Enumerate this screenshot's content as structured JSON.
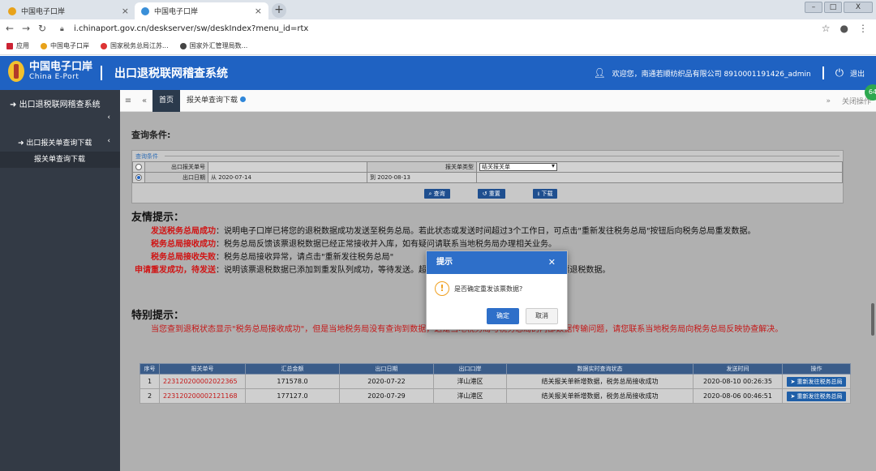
{
  "browser": {
    "tabs": [
      {
        "label": "中国电子口岸"
      },
      {
        "label": "中国电子口岸"
      }
    ],
    "url": "i.chinaport.gov.cn/deskserver/sw/deskIndex?menu_id=rtx",
    "bookmarks": [
      "应用",
      "中国电子口岸",
      "国家税务总局江苏...",
      "国家外汇管理局数..."
    ]
  },
  "header": {
    "logo_cn": "中国电子口岸",
    "logo_en": "China E-Port",
    "system_title": "出口退税联网稽查系统",
    "welcome": "欢迎您，南通若顺纺织品有限公司 8910001191426_admin",
    "logout": "退出"
  },
  "sidebar": {
    "main": "出口退税联网稽查系统",
    "sub": "出口报关单查询下载",
    "item": "报关单查询下载"
  },
  "tabbar": {
    "home": "首页",
    "tab": "报关单查询下载",
    "close_ops": "关闭操作"
  },
  "badge": "64",
  "query": {
    "title": "查询条件:",
    "legend": "查询条件",
    "label_decl_no": "出口报关单号",
    "label_decl_type": "报关单类型",
    "decl_type_value": "结关报关单",
    "label_export_date": "出口日期",
    "from": "从",
    "date_from": "2020-07-14",
    "to": "到",
    "date_to": "2020-08-13",
    "btn_search": "查询",
    "btn_reset": "重置",
    "btn_download": "下载"
  },
  "tips": {
    "title": "友情提示：",
    "rows": [
      {
        "k": "发送税务总局成功",
        "v": "：说明电子口岸已将您的退税数据成功发送至税务总局。若此状态或发送时间超过3个工作日，可点击\"重新发往税务总局\"按钮后向税务总局重发数据。"
      },
      {
        "k": "税务总局接收成功",
        "v": "：税务总局反馈该票退税数据已经正常接收并入库，如有疑问请联系当地税务局办理相关业务。"
      },
      {
        "k": "税务总局接收失败",
        "v": "：税务总局接收异常，请点击\"重新发往税务总局\""
      },
      {
        "k": "申请重发成功，待发送",
        "v": "：说明该票退税数据已添加到重发队列成功，等待发送。超过3个工作日后联系当地税务局查询该票退税数据。"
      }
    ]
  },
  "special": {
    "title": "特别提示：",
    "text": "当您查到退税状态显示\"税务总局接收成功\"，但是当地税务局没有查询到数据，这是当地税务局与税务总局的内部数据传输问题，请您联系当地税务局向税务总局反映协查解决。"
  },
  "results": {
    "headers": [
      "序号",
      "报关单号",
      "汇总金额",
      "出口日期",
      "出口口岸",
      "数据实时查询状态",
      "发送时间",
      "操作"
    ],
    "rows": [
      {
        "idx": "1",
        "no": "223120200002022365",
        "amount": "171578.0",
        "date": "2020-07-22",
        "port": "洋山港区",
        "status": "结关报关单新增数据，税务总局接收成功",
        "sent": "2020-08-10 00:26:35",
        "op": "重新发往税务总局"
      },
      {
        "idx": "2",
        "no": "223120200002121168",
        "amount": "177127.0",
        "date": "2020-07-29",
        "port": "洋山港区",
        "status": "结关报关单新增数据，税务总局接收成功",
        "sent": "2020-08-06 00:46:51",
        "op": "重新发往税务总局"
      }
    ]
  },
  "dialog": {
    "title": "提示",
    "message": "是否确定重发该票数据?",
    "ok": "确定",
    "cancel": "取消"
  },
  "colors": {
    "header_blue": "#1f62c2",
    "sidebar": "#333a45",
    "tip_red": "#d01414"
  }
}
